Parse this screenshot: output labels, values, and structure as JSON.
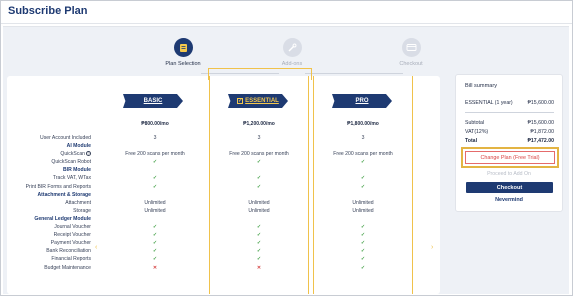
{
  "page": {
    "title": "Subscribe Plan"
  },
  "stepper": {
    "steps": [
      {
        "label": "Plan Selection",
        "icon": "document-icon",
        "state": "active"
      },
      {
        "label": "Add-ons",
        "icon": "tools-icon",
        "state": "inactive"
      },
      {
        "label": "Checkout",
        "icon": "card-icon",
        "state": "inactive"
      }
    ]
  },
  "features": [
    "User Account Included",
    "AI Module",
    "QuickScan",
    "QuickScan Robot",
    "BIR Module",
    "Track VAT, WTax",
    "Print BIR Forms and Reports",
    "Attachment & Storage",
    "Attachment",
    "Storage",
    "General Ledger Module",
    "Journal Voucher",
    "Receipt Voucher",
    "Payment Voucher",
    "Bank Reconciliation",
    "Financial Reports",
    "Budget Maintenance"
  ],
  "plans": [
    {
      "name": "BASIC",
      "price": "₱800.00/mo",
      "selected": false,
      "values": [
        "3",
        "",
        "Free 200 scans per month",
        "✓",
        "",
        "✓",
        "✓",
        "",
        "Unlimited",
        "Unlimited",
        "",
        "✓",
        "✓",
        "✓",
        "✓",
        "✓",
        "✕"
      ]
    },
    {
      "name": "ESSENTIAL",
      "price": "₱1,200.00/mo",
      "selected": true,
      "values": [
        "3",
        "",
        "Free 200 scans per month",
        "✓",
        "",
        "✓",
        "✓",
        "",
        "Unlimited",
        "Unlimited",
        "",
        "✓",
        "✓",
        "✓",
        "✓",
        "✓",
        "✕"
      ]
    },
    {
      "name": "PRO",
      "price": "₱1,800.00/mo",
      "selected": false,
      "values": [
        "3",
        "",
        "Free 200 scans per month",
        "✓",
        "",
        "✓",
        "✓",
        "",
        "Unlimited",
        "Unlimited",
        "",
        "✓",
        "✓",
        "✓",
        "✓",
        "✓",
        "✓"
      ]
    }
  ],
  "bill": {
    "heading": "Bill summary",
    "item_label": "ESSENTIAL (1 year)",
    "item_value": "₱15,600.00",
    "subtotal_label": "Subtotal",
    "subtotal_value": "₱15,600.00",
    "vat_label": "VAT(12%)",
    "vat_value": "₱1,872.00",
    "total_label": "Total",
    "total_value": "₱17,472.00",
    "change_plan": "Change Plan (Free Trial)",
    "proceed": "Proceed to Add On",
    "checkout": "Checkout",
    "nevermind": "Nevermind"
  },
  "colors": {
    "brand": "#1e3a72",
    "accent": "#f0c24b",
    "check": "#43a047",
    "cross": "#d64545"
  }
}
